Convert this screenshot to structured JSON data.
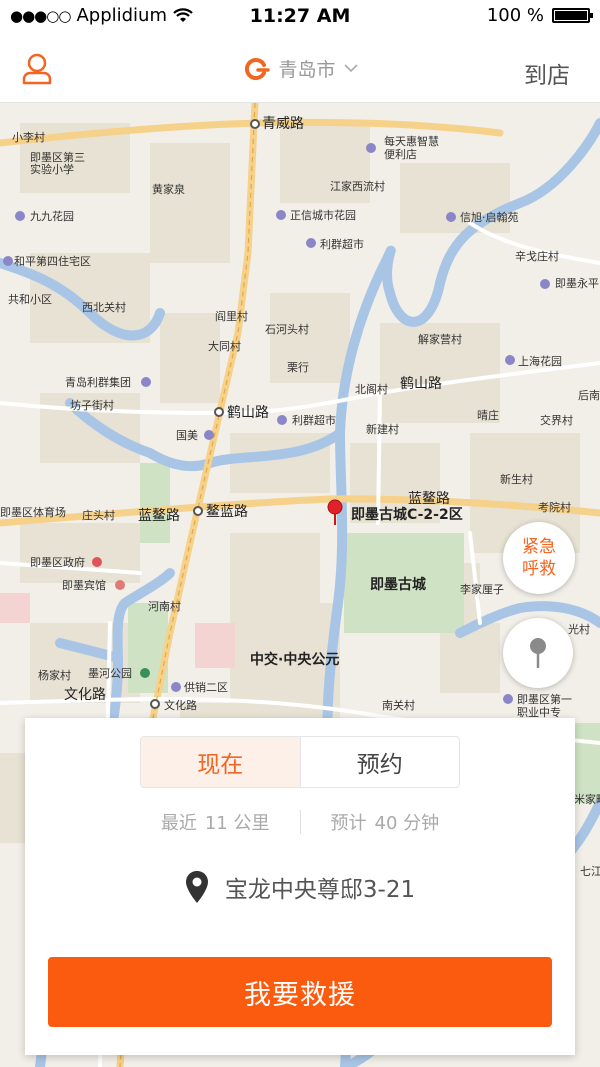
{
  "status_bar": {
    "carrier": "Applidium",
    "time": "11:27 AM",
    "battery": "100 %"
  },
  "nav": {
    "city": "青岛市",
    "right_label": "到店",
    "colors": {
      "accent": "#f26522"
    }
  },
  "map": {
    "labels": [
      "青威路",
      "小李村",
      "即墨区第三",
      "实验小学",
      "每天惠智慧",
      "便利店",
      "黄家泉",
      "江家西流村",
      "九九花园",
      "正信城市花园",
      "信旭·启翰苑",
      "利群超市",
      "辛戈庄村",
      "即墨永平",
      "和平第四住宅区",
      "共和小区",
      "西北关村",
      "阎里村",
      "石河头村",
      "解家营村",
      "大同村",
      "上海花园",
      "栗行",
      "北阁村",
      "鹤山路",
      "青岛利群集团",
      "坊子街村",
      "后南",
      "鹤山路",
      "利群超市",
      "晴庄",
      "交界村",
      "国美",
      "新建村",
      "新生村",
      "蓝鳌路",
      "考院村",
      "即墨区体育场",
      "庄头村",
      "蓝鳌路",
      "鳌蓝路",
      "即墨古城C-2-2区",
      "即墨区政府",
      "即墨古城",
      "即墨宾馆",
      "李家厘子",
      "河南村",
      "中交·中央公元",
      "杨家村",
      "墨河公园",
      "供销二区",
      "文化路",
      "文化路",
      "南关村",
      "即墨区第一",
      "职业中专",
      "光村",
      "米家疃",
      "七江"
    ]
  },
  "buttons": {
    "emergency_line1": "紧急",
    "emergency_line2": "呼救"
  },
  "card": {
    "tabs": [
      "现在",
      "预约"
    ],
    "distance_label": "最近",
    "distance_value": "11 公里",
    "eta_label": "预计",
    "eta_value": "40 分钟",
    "address": "宝龙中央尊邸3-21",
    "action_label": "我要救援"
  }
}
